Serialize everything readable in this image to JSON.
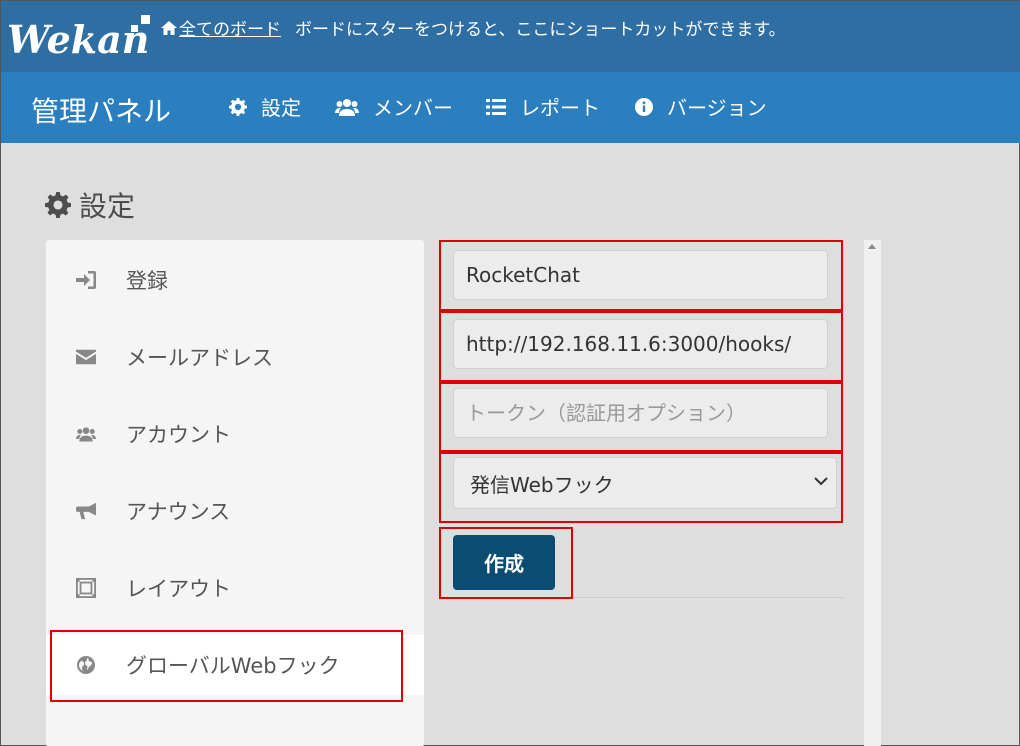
{
  "header": {
    "logo_text": "Wekan",
    "all_boards_link": "全てのボード",
    "star_message": "ボードにスターをつけると、ここにショートカットができます。"
  },
  "navbar": {
    "title": "管理パネル",
    "items": [
      {
        "label": "設定",
        "icon": "gear-icon"
      },
      {
        "label": "メンバー",
        "icon": "users-icon"
      },
      {
        "label": "レポート",
        "icon": "list-icon"
      },
      {
        "label": "バージョン",
        "icon": "info-icon"
      }
    ]
  },
  "page": {
    "title": "設定"
  },
  "sidebar": {
    "items": [
      {
        "label": "登録",
        "icon": "sign-in-icon"
      },
      {
        "label": "メールアドレス",
        "icon": "envelope-icon"
      },
      {
        "label": "アカウント",
        "icon": "users-icon"
      },
      {
        "label": "アナウンス",
        "icon": "bullhorn-icon"
      },
      {
        "label": "レイアウト",
        "icon": "layout-icon"
      },
      {
        "label": "グローバルWebフック",
        "icon": "globe-icon",
        "active": true
      }
    ]
  },
  "form": {
    "title_value": "RocketChat",
    "url_value": "http://192.168.11.6:3000/hooks/",
    "token_placeholder": "トークン（認証用オプション）",
    "type_selected": "発信Webフック",
    "create_button": "作成"
  },
  "colors": {
    "topbar": "#2f6ea3",
    "navbar": "#2b7fbe",
    "button": "#0b4c73",
    "highlight": "#e00000"
  }
}
